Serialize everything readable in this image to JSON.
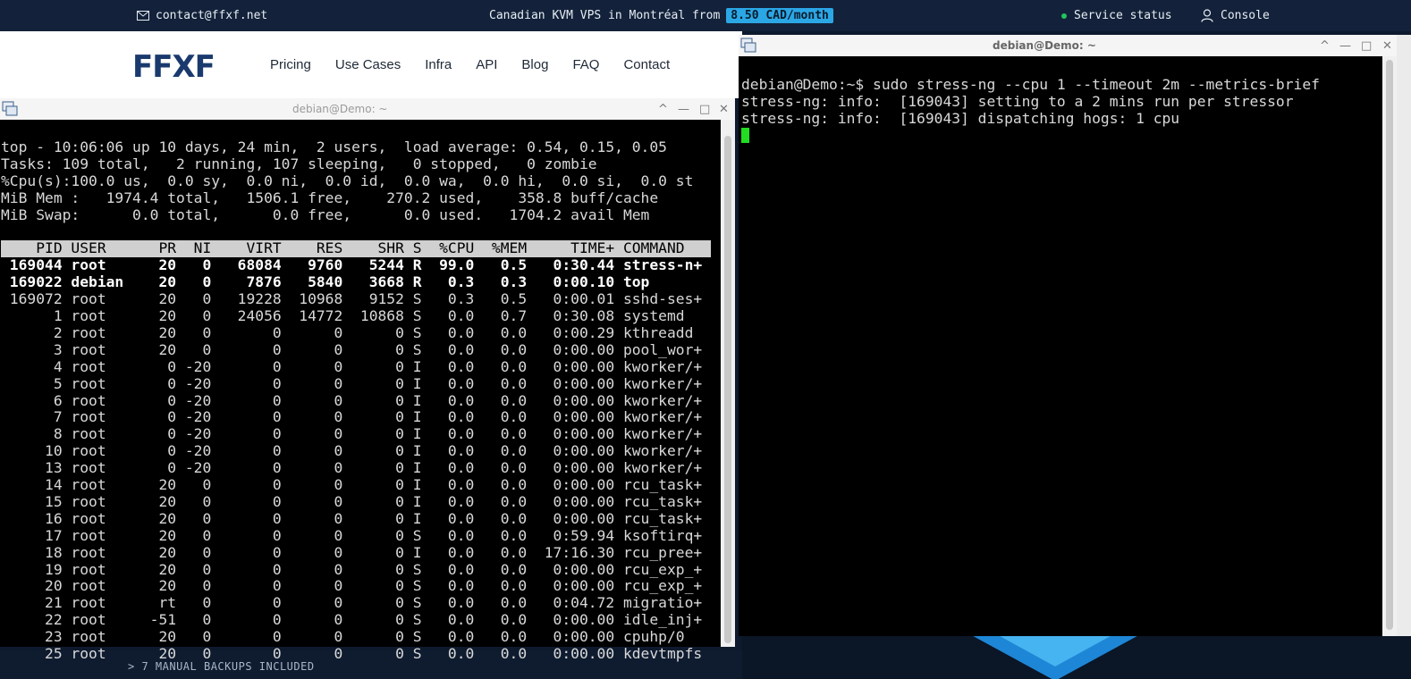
{
  "topbar": {
    "contact": "contact@ffxf.net",
    "promo": "Canadian KVM VPS in Montréal from",
    "price": "8.50 CAD/month",
    "status": "Service status",
    "console": "Console"
  },
  "site": {
    "logo": "FFXF",
    "nav": [
      "Pricing",
      "Use Cases",
      "Infra",
      "API",
      "Blog",
      "FAQ",
      "Contact"
    ],
    "bottom_text": "> 7 MANUAL BACKUPS INCLUDED"
  },
  "term_left": {
    "title": "debian@Demo: ~",
    "summary": [
      "top - 10:06:06 up 10 days, 24 min,  2 users,  load average: 0.54, 0.15, 0.05",
      "Tasks: 109 total,   2 running, 107 sleeping,   0 stopped,   0 zombie",
      "%Cpu(s):100.0 us,  0.0 sy,  0.0 ni,  0.0 id,  0.0 wa,  0.0 hi,  0.0 si,  0.0 st",
      "MiB Mem :   1974.4 total,   1506.1 free,    270.2 used,    358.8 buff/cache",
      "MiB Swap:      0.0 total,      0.0 free,      0.0 used.   1704.2 avail Mem"
    ],
    "header": "    PID USER      PR  NI    VIRT    RES    SHR S  %CPU  %MEM     TIME+ COMMAND   ",
    "rows": [
      {
        "text": " 169044 root      20   0   68084   9760   5244 R  99.0   0.5   0:30.44 stress-n+",
        "bold": true
      },
      {
        "text": " 169022 debian    20   0    7876   5840   3668 R   0.3   0.3   0:00.10 top",
        "bold": true
      },
      {
        "text": " 169072 root      20   0   19228  10968   9152 S   0.3   0.5   0:00.01 sshd-ses+",
        "bold": false
      },
      {
        "text": "      1 root      20   0   24056  14772  10868 S   0.0   0.7   0:30.08 systemd",
        "bold": false
      },
      {
        "text": "      2 root      20   0       0      0      0 S   0.0   0.0   0:00.29 kthreadd",
        "bold": false
      },
      {
        "text": "      3 root      20   0       0      0      0 S   0.0   0.0   0:00.00 pool_wor+",
        "bold": false
      },
      {
        "text": "      4 root       0 -20       0      0      0 I   0.0   0.0   0:00.00 kworker/+",
        "bold": false
      },
      {
        "text": "      5 root       0 -20       0      0      0 I   0.0   0.0   0:00.00 kworker/+",
        "bold": false
      },
      {
        "text": "      6 root       0 -20       0      0      0 I   0.0   0.0   0:00.00 kworker/+",
        "bold": false
      },
      {
        "text": "      7 root       0 -20       0      0      0 I   0.0   0.0   0:00.00 kworker/+",
        "bold": false
      },
      {
        "text": "      8 root       0 -20       0      0      0 I   0.0   0.0   0:00.00 kworker/+",
        "bold": false
      },
      {
        "text": "     10 root       0 -20       0      0      0 I   0.0   0.0   0:00.00 kworker/+",
        "bold": false
      },
      {
        "text": "     13 root       0 -20       0      0      0 I   0.0   0.0   0:00.00 kworker/+",
        "bold": false
      },
      {
        "text": "     14 root      20   0       0      0      0 I   0.0   0.0   0:00.00 rcu_task+",
        "bold": false
      },
      {
        "text": "     15 root      20   0       0      0      0 I   0.0   0.0   0:00.00 rcu_task+",
        "bold": false
      },
      {
        "text": "     16 root      20   0       0      0      0 I   0.0   0.0   0:00.00 rcu_task+",
        "bold": false
      },
      {
        "text": "     17 root      20   0       0      0      0 S   0.0   0.0   0:59.94 ksoftirq+",
        "bold": false
      },
      {
        "text": "     18 root      20   0       0      0      0 I   0.0   0.0  17:16.30 rcu_pree+",
        "bold": false
      },
      {
        "text": "     19 root      20   0       0      0      0 S   0.0   0.0   0:00.00 rcu_exp_+",
        "bold": false
      },
      {
        "text": "     20 root      20   0       0      0      0 S   0.0   0.0   0:00.00 rcu_exp_+",
        "bold": false
      },
      {
        "text": "     21 root      rt   0       0      0      0 S   0.0   0.0   0:04.72 migratio+",
        "bold": false
      },
      {
        "text": "     22 root     -51   0       0      0      0 S   0.0   0.0   0:00.00 idle_inj+",
        "bold": false
      },
      {
        "text": "     23 root      20   0       0      0      0 S   0.0   0.0   0:00.00 cpuhp/0",
        "bold": false
      },
      {
        "text": "     25 root      20   0       0      0      0 S   0.0   0.0   0:00.00 kdevtmpfs",
        "bold": false
      }
    ]
  },
  "term_right": {
    "title": "debian@Demo: ~",
    "lines": [
      "debian@Demo:~$ sudo stress-ng --cpu 1 --timeout 2m --metrics-brief",
      "stress-ng: info:  [169043] setting to a 2 mins run per stressor",
      "stress-ng: info:  [169043] dispatching hogs: 1 cpu"
    ]
  }
}
